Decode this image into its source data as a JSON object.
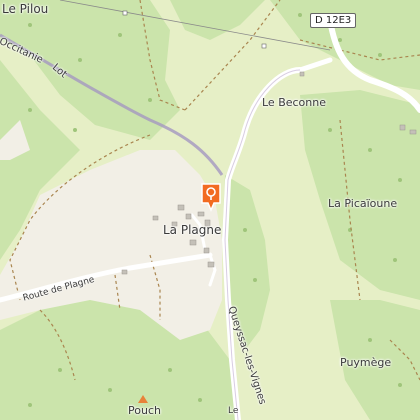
{
  "map": {
    "places": {
      "le_pilou": "Le Pilou",
      "le_beconne": "Le Beconne",
      "la_picaioune": "La Picaïoune",
      "la_plagne": "La Plagne",
      "puymege": "Puymège",
      "pouch": "Pouch"
    },
    "roads": {
      "occitanie": "Occitanie",
      "lot": "Lot",
      "route_de_plagne": "Route de Plagne",
      "queyssac": "Queyssac-les-Vignes",
      "d12e3": "D 12E3",
      "partial_le": "Le"
    },
    "marker": {
      "icon": "location-pin-icon",
      "color": "#f26b21"
    },
    "colors": {
      "forest": "#c9e3a9",
      "meadow": "#e4efc2",
      "bare": "#f3f0e8",
      "road": "#ffffff",
      "track": "#a9854f",
      "boundary": "#9b8fb0"
    }
  }
}
